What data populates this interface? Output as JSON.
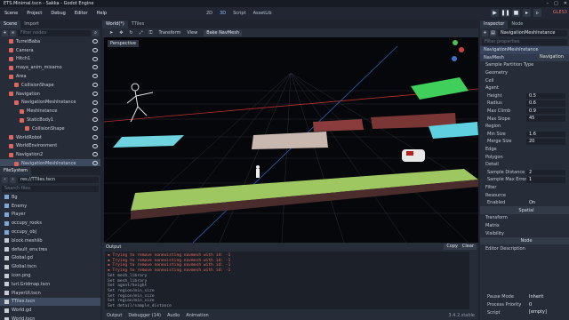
{
  "window": {
    "title": "ETS.Minimal.tscn - Sakka - Godot Engine",
    "controls": [
      "–",
      "□",
      "✕"
    ]
  },
  "menu": [
    "Scene",
    "Project",
    "Debug",
    "Editor",
    "Help"
  ],
  "workspaces": [
    "2D",
    "3D",
    "Script",
    "AssetLib"
  ],
  "renderer": "GLES3",
  "scene_panel": {
    "tabs": [
      "Scene",
      "Import"
    ],
    "filter_placeholder": "Filter nodes",
    "nodes": [
      {
        "label": "TurretBaba",
        "depth": 1,
        "color": "#e0655c"
      },
      {
        "label": "Camera",
        "depth": 1,
        "color": "#e0655c"
      },
      {
        "label": "Hitch1",
        "depth": 1,
        "color": "#e0655c"
      },
      {
        "label": "maya_anim_mixamo",
        "depth": 1,
        "color": "#e0655c"
      },
      {
        "label": "Area",
        "depth": 1,
        "color": "#e0655c"
      },
      {
        "label": "CollisionShape",
        "depth": 2,
        "color": "#e0655c"
      },
      {
        "label": "Navigation",
        "depth": 1,
        "color": "#e0655c"
      },
      {
        "label": "NavigationMeshInstance",
        "depth": 2,
        "color": "#e0655c"
      },
      {
        "label": "MeshInstance",
        "depth": 3,
        "color": "#e0655c"
      },
      {
        "label": "StaticBody1",
        "depth": 3,
        "color": "#e0655c"
      },
      {
        "label": "CollisionShape",
        "depth": 4,
        "color": "#e0655c"
      },
      {
        "label": "WorldRobot",
        "depth": 1,
        "color": "#e0655c"
      },
      {
        "label": "WorldEnvironment",
        "depth": 1,
        "color": "#e0655c"
      },
      {
        "label": "Navigation2",
        "depth": 1,
        "color": "#e0655c"
      },
      {
        "label": "NavigationMeshInstance",
        "depth": 2,
        "color": "#e0655c",
        "selected": true
      },
      {
        "label": "GridMap",
        "depth": 2,
        "color": "#e0655c"
      }
    ]
  },
  "filesystem": {
    "title": "FileSystem",
    "path": "res://TTiles.tscn",
    "search_placeholder": "Search files",
    "items": [
      {
        "label": "Bg",
        "type": "folder"
      },
      {
        "label": "Enemy",
        "type": "folder"
      },
      {
        "label": "Player",
        "type": "folder"
      },
      {
        "label": "occupy_rooks",
        "type": "folder"
      },
      {
        "label": "occupy_obj",
        "type": "folder"
      },
      {
        "label": "block.meshlib",
        "type": "file"
      },
      {
        "label": "default_env.tres",
        "type": "file"
      },
      {
        "label": "Global.gd",
        "type": "file"
      },
      {
        "label": "Global.tscn",
        "type": "file"
      },
      {
        "label": "icon.png",
        "type": "file"
      },
      {
        "label": "lurl.Gridmap.tscn",
        "type": "file"
      },
      {
        "label": "PlayerUI.tscn",
        "type": "file"
      },
      {
        "label": "TTiles.tscn",
        "type": "file",
        "selected": true
      },
      {
        "label": "World.gd",
        "type": "file"
      },
      {
        "label": "World.tscn",
        "type": "file"
      }
    ]
  },
  "viewport": {
    "tabs": [
      "World(*)",
      "TTiles"
    ],
    "toolbar": [
      "Transform",
      "View",
      "Bake NavMesh"
    ],
    "perspective": "Perspective"
  },
  "output": {
    "title": "Output",
    "copy": "Copy",
    "clear": "Clear",
    "lines": [
      {
        "text": "▪ Trying to remove nonexisting navmesh with id: -1",
        "error": true
      },
      {
        "text": "▪ Trying to remove nonexisting navmesh with id: -1",
        "error": true
      },
      {
        "text": "▪ Trying to remove nonexisting navmesh with id: -1",
        "error": true
      },
      {
        "text": "▪ Trying to remove nonexisting navmesh with id: -1",
        "error": true
      },
      {
        "text": "Set mesh_library",
        "error": false
      },
      {
        "text": "Set mesh_library",
        "error": false
      },
      {
        "text": "Set agent/height",
        "error": false
      },
      {
        "text": "Set region/min_size",
        "error": false
      },
      {
        "text": "Set region/min_size",
        "error": false
      },
      {
        "text": "Set region/min_size",
        "error": false
      },
      {
        "text": "Set detail/sample_distance",
        "error": false
      }
    ],
    "footer": [
      "Output",
      "Debugger (14)",
      "Audio",
      "Animation"
    ],
    "version": "3.4.2.stable"
  },
  "inspector": {
    "tabs": [
      "Inspector",
      "Node"
    ],
    "node_name": "NavigationMeshInstance",
    "filter_placeholder": "Filter properties",
    "breadcrumb": "NavigationMeshInstance",
    "resource": "NavMesh",
    "resource_btn": "Navigation",
    "sections": [
      {
        "kind": "sub",
        "label": "Sample Partition Type"
      },
      {
        "kind": "sub",
        "label": "Geometry"
      },
      {
        "kind": "sub",
        "label": "Cell"
      },
      {
        "kind": "sub",
        "label": "Agent"
      },
      {
        "kind": "prop",
        "label": "Height",
        "value": "0.5"
      },
      {
        "kind": "prop",
        "label": "Radius",
        "value": "0.6"
      },
      {
        "kind": "prop",
        "label": "Max Climb",
        "value": "0.9"
      },
      {
        "kind": "prop",
        "label": "Max Slope",
        "value": "45"
      },
      {
        "kind": "sub",
        "label": "Region"
      },
      {
        "kind": "prop",
        "label": "Min Size",
        "value": "1.6"
      },
      {
        "kind": "prop",
        "label": "Merge Size",
        "value": "20"
      },
      {
        "kind": "sub",
        "label": "Edge"
      },
      {
        "kind": "sub",
        "label": "Polygon"
      },
      {
        "kind": "sub",
        "label": "Detail"
      },
      {
        "kind": "prop",
        "label": "Sample Distance",
        "value": "2"
      },
      {
        "kind": "prop",
        "label": "Sample Max Error",
        "value": "1"
      },
      {
        "kind": "sub",
        "label": "Filter"
      },
      {
        "kind": "sub",
        "label": "Resource"
      }
    ],
    "enabled_label": "Enabled",
    "enabled_value": "On",
    "spatial": "Spatial",
    "groups": [
      "Transform",
      "Matrix",
      "Visibility"
    ],
    "node_label": "Node",
    "editor_desc": "Editor Description",
    "pause_mode_label": "Pause Mode",
    "pause_mode": "Inherit",
    "priority_label": "Process Priority",
    "priority": "0",
    "script_label": "Script",
    "script": "[empty]"
  }
}
